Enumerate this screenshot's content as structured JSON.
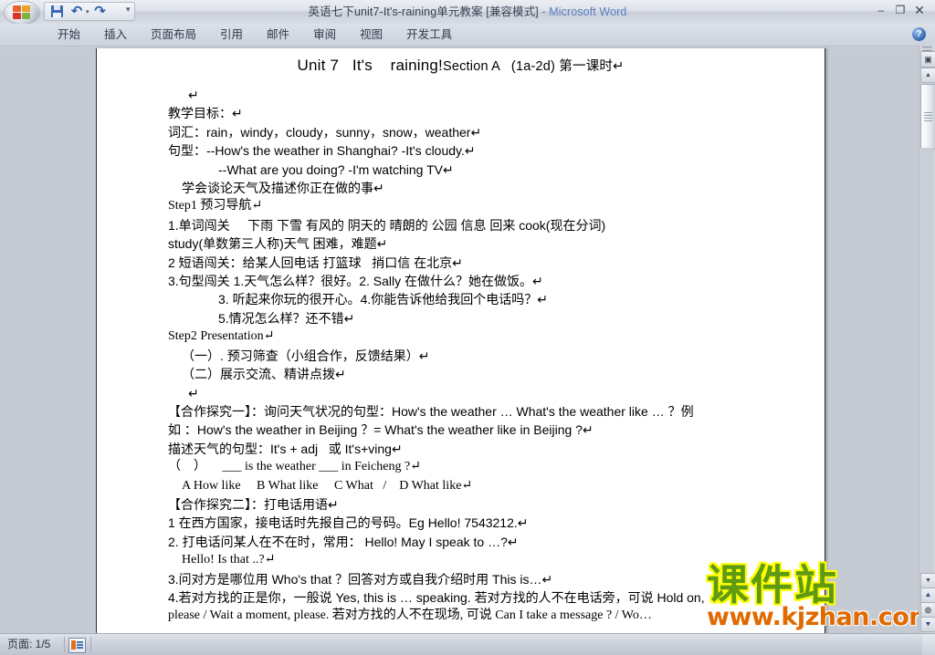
{
  "window": {
    "title": "英语七下unit7-It's-raining单元教案 [兼容模式]",
    "separator": " - ",
    "app_name": "Microsoft Word",
    "minimize": "–",
    "restore": "❐",
    "close": "✕"
  },
  "quick_access": {
    "save_label": "保存",
    "undo_label": "↺",
    "undo_glyph": "↶",
    "redo_glyph": "↷",
    "caret": "▾",
    "more_glyph": "▾"
  },
  "ribbon": {
    "tabs": [
      {
        "label": "开始"
      },
      {
        "label": "插入"
      },
      {
        "label": "页面布局"
      },
      {
        "label": "引用"
      },
      {
        "label": "邮件"
      },
      {
        "label": "审阅"
      },
      {
        "label": "视图"
      },
      {
        "label": "开发工具"
      }
    ],
    "help_glyph": "?"
  },
  "document": {
    "title_main": "Unit 7   It's    raining!",
    "title_section": "Section A   (1a-2d) 第一课时↵",
    "lines": [
      {
        "text": "↵",
        "style": "pilcrow-only",
        "indent": 1
      },
      {
        "text": "教学目标：↵",
        "indent": 0
      },
      {
        "text": "词汇：rain，windy，cloudy，sunny，snow，weather↵",
        "indent": 0
      },
      {
        "text": "句型：--How's the weather in Shanghai? -It's cloudy.↵",
        "indent": 0
      },
      {
        "text": "--What are you doing? -I'm watching TV↵",
        "indent": 2
      },
      {
        "text": "学会谈论天气及描述你正在做的事↵",
        "indent": 1
      },
      {
        "text": "Step1 预习导航↵",
        "indent": 0
      },
      {
        "text": "1.单词闯关     下雨 下雪 有风的 阴天的 晴朗的 公园 信息 回来 cook(现在分词)",
        "indent": 0
      },
      {
        "text": "study(单数第三人称)天气 困难，难题↵",
        "indent": 0
      },
      {
        "text": "2 短语闯关：给某人回电话 打篮球   捎口信 在北京↵",
        "indent": 0
      },
      {
        "text": "3.句型闯关 1.天气怎么样？很好。2. Sally 在做什么？她在做饭。↵",
        "indent": 0
      },
      {
        "text": "3. 听起来你玩的很开心。4.你能告诉他给我回个电话吗？↵",
        "indent": 2
      },
      {
        "text": "5.情况怎么样？还不错↵",
        "indent": 2
      },
      {
        "text": "Step2 Presentation↵",
        "indent": 0
      },
      {
        "text": "（一）. 预习筛查（小组合作，反馈结果）↵",
        "indent": 1
      },
      {
        "text": "（二）展示交流、精讲点拨↵",
        "indent": 1
      },
      {
        "text": "↵",
        "style": "pilcrow-only",
        "indent": 1
      },
      {
        "text": "【合作探究一】：询问天气状况的句型：How's the weather … What's the weather like … ？例",
        "indent": 0
      },
      {
        "text": "如 ：How's the weather in Beijing ？= What's the weather like in Beijing ?↵",
        "indent": 0
      },
      {
        "text": "描述天气的句型：It's + adj   或 It's+ving↵",
        "indent": 0
      },
      {
        "text": "（    ）     ___ is the weather ___ in Feicheng ?↵",
        "indent": 0
      },
      {
        "text": "A How like     B What like     C What   /    D What like↵",
        "indent": 1
      },
      {
        "text": "【合作探究二】：打电话用语↵",
        "indent": 0
      },
      {
        "text": "1 在西方国家，接电话时先报自己的号码。Eg Hello! 7543212.↵",
        "indent": 0
      },
      {
        "text": "2. 打电话问某人在不在时，常用： Hello! May I speak to …?↵",
        "indent": 0
      },
      {
        "text": "Hello! Is that ..?↵",
        "indent": 1
      },
      {
        "text": "3.问对方是哪位用 Who's that ？回答对方或自我介绍时用 This is…↵",
        "indent": 0
      },
      {
        "text": "4.若对方找的正是你，一般说 Yes, this is … speaking. 若对方找的人不在电话旁，可说 Hold on,",
        "indent": 0
      },
      {
        "text": "please / Wait a moment, please. 若对方找的人不在现场, 可说 Can I take a message ? / Wo…",
        "indent": 0
      }
    ]
  },
  "watermark": {
    "chinese": "课件站",
    "url": "www.kjzhan.com",
    "color_green": "#5f9a13",
    "color_yellow": "#ffff00",
    "color_orange": "#e06a00"
  },
  "scrollbar": {
    "view_glyph": "▣",
    "up_glyph": "▲",
    "down_glyph": "▼",
    "prev_page_glyph": "⯅",
    "select_object_glyph": "◎",
    "next_page_glyph": "⯆"
  },
  "statusbar": {
    "page_label": "页面: 1/5"
  }
}
